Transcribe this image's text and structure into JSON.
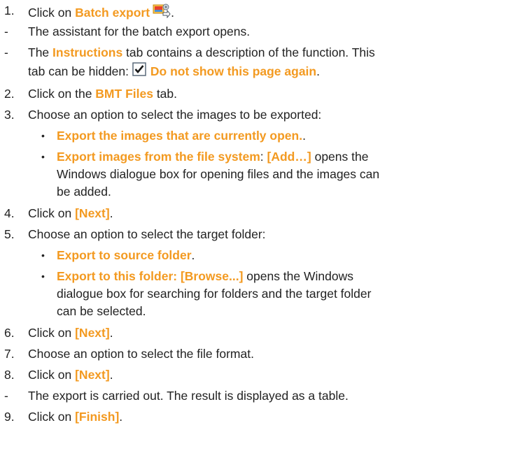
{
  "steps": {
    "s1": {
      "marker": "1.",
      "pre": "Click on ",
      "hl": "Batch export",
      "post": "."
    },
    "d1": {
      "marker": "-",
      "text": "The assistant for the batch export opens."
    },
    "d2": {
      "marker": "-",
      "pre": "The ",
      "hl": "Instructions",
      "post": " tab contains a description of the function. This",
      "line2_pre": "tab can be hidden: ",
      "line2_hl": "Do not show this page again",
      "line2_post": "."
    },
    "s2": {
      "marker": "2.",
      "pre": "Click on the ",
      "hl": "BMT Files",
      "post": " tab."
    },
    "s3": {
      "marker": "3.",
      "text": "Choose an option to select the images to be exported:"
    },
    "b3a": {
      "marker": "•",
      "hl": "Export the images that are currently open.",
      "post": "."
    },
    "b3b": {
      "marker": "•",
      "hl": "Export images from the file system",
      "mid": ": ",
      "hl2": "[Add…]",
      "post": " opens the",
      "line2": "Windows dialogue box for opening files and the images can",
      "line3": "be added."
    },
    "s4": {
      "marker": "4.",
      "pre": "Click on ",
      "hl": "[Next]",
      "post": "."
    },
    "s5": {
      "marker": "5.",
      "text": "Choose an option to select the target folder:"
    },
    "b5a": {
      "marker": "•",
      "hl": "Export to source folder",
      "post": "."
    },
    "b5b": {
      "marker": "•",
      "hl": "Export to this folder: [Browse...]",
      "post": " opens the Windows",
      "line2": "dialogue box for searching for folders and the target folder",
      "line3": "can be selected."
    },
    "s6": {
      "marker": "6.",
      "pre": "Click on ",
      "hl": "[Next]",
      "post": "."
    },
    "s7": {
      "marker": "7.",
      "text": "Choose an option to select the file format."
    },
    "s8": {
      "marker": "8.",
      "pre": "Click on ",
      "hl": "[Next]",
      "post": "."
    },
    "d3": {
      "marker": "-",
      "text": "The export is carried out. The result is displayed as a table."
    },
    "s9": {
      "marker": "9.",
      "pre": "Click on ",
      "hl": "[Finish]",
      "post": "."
    }
  },
  "icons": {
    "batch_export": "batch-export-icon",
    "checkbox": "checkbox-checked-icon"
  },
  "colors": {
    "highlight": "#f39a21",
    "text": "#222222"
  }
}
